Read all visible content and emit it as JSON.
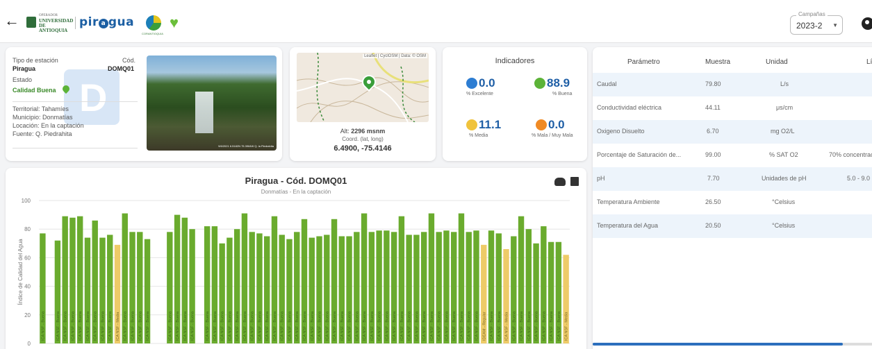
{
  "header": {
    "udea_small": "OPERADOR",
    "udea_name": "UNIVERSIDAD DE ANTIOQUIA",
    "piragua_logo": "pir",
    "piragua_logo_end": "gua",
    "cornare": "CORANTIOQUIA",
    "campaign_label": "Campañas",
    "campaign_value": "2023-2"
  },
  "station": {
    "type_label": "Tipo de estación",
    "type_value": "Piragua",
    "code_label": "Cód.",
    "code_value": "DOMQ01",
    "state_label": "Estado",
    "state_value": "Calidad Buena",
    "territorial": "Territorial: Tahamíes",
    "municipio": "Municipio: Donmatías",
    "locacion": "Locación: En la captación",
    "fuente": "Fuente: Q. Piedrahita",
    "photo_caption": "9/6/2021 6.5182N 75.3964W Q. la Piedrahita"
  },
  "map": {
    "attribution": "Leaflet | CyclOSM | Data: © OSM",
    "alt_label": "Alt:",
    "alt_value": "2296 msnm",
    "coord_label": "Coord. (lat, long)",
    "coord_value": "6.4900, -75.4146"
  },
  "indicators": {
    "title": "Indicadores",
    "items": [
      {
        "value": "0.0",
        "label": "% Excelente",
        "color": "#2d7dd2"
      },
      {
        "value": "88.9",
        "label": "% Buena",
        "color": "#5cb338"
      },
      {
        "value": "11.1",
        "label": "% Media",
        "color": "#f0c33c"
      },
      {
        "value": "0.0",
        "label": "% Mala / Muy Mala",
        "color": "#f08a24"
      }
    ]
  },
  "chart": {
    "title": "Piragua - Cód. DOMQ01",
    "subtitle": "Donmatías - En la captación"
  },
  "chart_data": {
    "type": "bar",
    "ylabel": "Índice de Calidad del Agua",
    "ylim": [
      0,
      100
    ],
    "yticks": [
      0,
      20,
      40,
      60,
      80,
      100
    ],
    "colors": {
      "good": "#6aab2e",
      "medium": "#eecb68"
    },
    "bar_text": {
      "good": "ICA NSF - Buena",
      "medium": "ICA NSF - Media",
      "regular": "IDEAM - Regular"
    },
    "values": [
      77,
      0,
      72,
      89,
      88,
      89,
      74,
      86,
      74,
      76,
      69,
      91,
      78,
      78,
      73,
      0,
      0,
      78,
      90,
      88,
      80,
      0,
      82,
      82,
      70,
      74,
      80,
      91,
      78,
      77,
      75,
      89,
      76,
      73,
      78,
      87,
      74,
      75,
      76,
      87,
      75,
      75,
      78,
      91,
      78,
      79,
      79,
      78,
      89,
      76,
      76,
      78,
      91,
      78,
      79,
      78,
      91,
      78,
      79,
      69,
      79,
      77,
      66,
      75,
      89,
      80,
      70,
      82,
      71,
      71,
      62
    ],
    "status": [
      "g",
      "g",
      "g",
      "g",
      "g",
      "g",
      "g",
      "g",
      "g",
      "g",
      "m",
      "g",
      "g",
      "g",
      "g",
      "g",
      "g",
      "g",
      "g",
      "g",
      "g",
      "g",
      "g",
      "g",
      "g",
      "g",
      "g",
      "g",
      "g",
      "g",
      "g",
      "g",
      "g",
      "g",
      "g",
      "g",
      "g",
      "g",
      "g",
      "g",
      "g",
      "g",
      "g",
      "g",
      "g",
      "g",
      "g",
      "g",
      "g",
      "g",
      "g",
      "g",
      "g",
      "g",
      "g",
      "g",
      "g",
      "g",
      "g",
      "m",
      "g",
      "g",
      "m",
      "g",
      "g",
      "g",
      "g",
      "g",
      "g",
      "g",
      "m"
    ]
  },
  "table": {
    "headers": [
      "Parámetro",
      "Muestra",
      "Unidad",
      "Lí"
    ],
    "rows": [
      {
        "param": "Caudal",
        "muestra": "79.80",
        "unidad": "L/s",
        "limite": ""
      },
      {
        "param": "Conductividad eléctrica",
        "muestra": "44.11",
        "unidad": "μs/cm",
        "limite": ""
      },
      {
        "param": "Oxigeno Disuelto",
        "muestra": "6.70",
        "unidad": "mg O2/L",
        "limite": ""
      },
      {
        "param": "Porcentaje de Saturación de...",
        "muestra": "99.00",
        "unidad": "% SAT O2",
        "limite": "70% concentrac"
      },
      {
        "param": "pH",
        "muestra": "7.70",
        "unidad": "Unidades de pH",
        "limite": "5.0 - 9.0"
      },
      {
        "param": "Temperatura Ambiente",
        "muestra": "26.50",
        "unidad": "°Celsius",
        "limite": ""
      },
      {
        "param": "Temperatura del Agua",
        "muestra": "20.50",
        "unidad": "°Celsius",
        "limite": ""
      }
    ]
  }
}
